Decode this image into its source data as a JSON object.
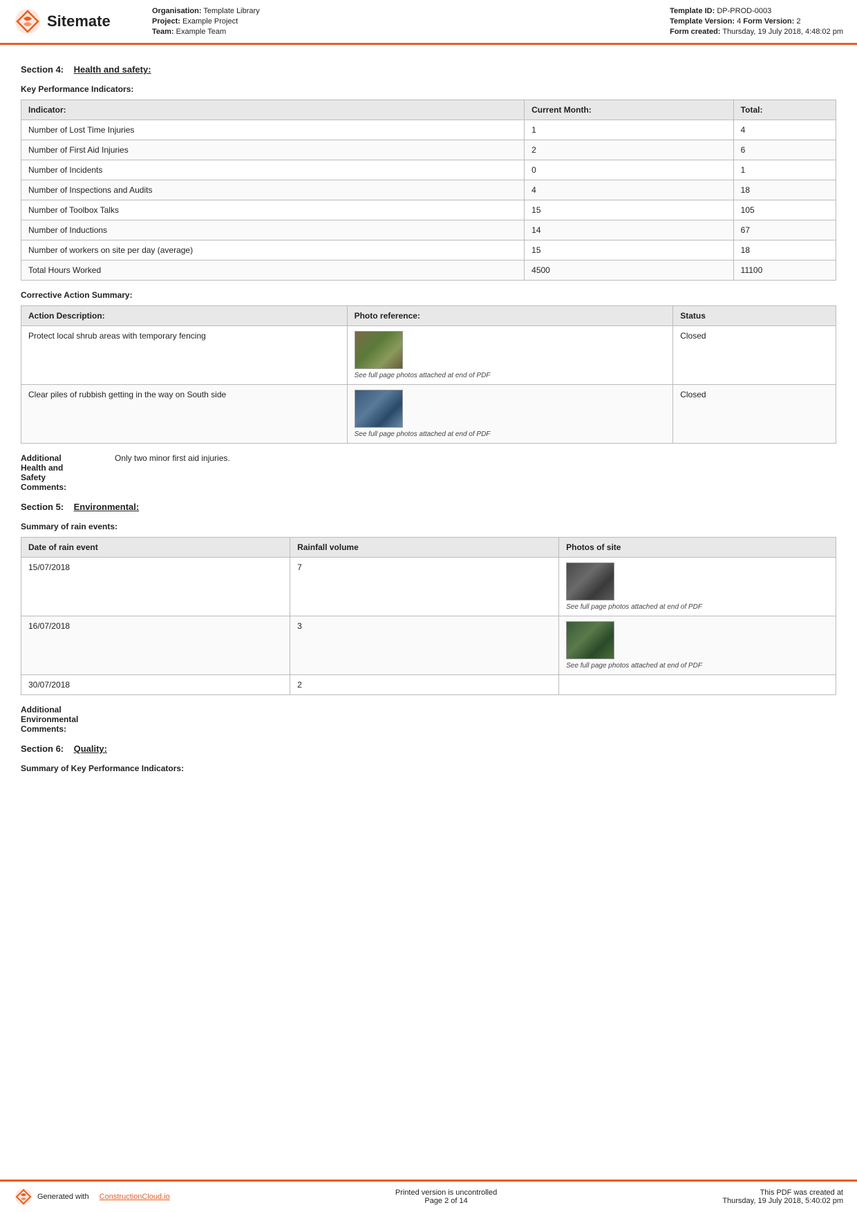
{
  "header": {
    "logo_text": "Sitemate",
    "organisation_label": "Organisation:",
    "organisation_value": "Template Library",
    "project_label": "Project:",
    "project_value": "Example Project",
    "team_label": "Team:",
    "team_value": "Example Team",
    "template_id_label": "Template ID:",
    "template_id_value": "DP-PROD-0003",
    "template_version_label": "Template Version:",
    "template_version_value": "4",
    "form_version_label": "Form Version:",
    "form_version_value": "2",
    "form_created_label": "Form created:",
    "form_created_value": "Thursday, 19 July 2018, 4:48:02 pm"
  },
  "section4": {
    "label": "Section 4:",
    "title": "Health and safety:"
  },
  "kpi": {
    "heading": "Key Performance Indicators:",
    "columns": [
      "Indicator:",
      "Current Month:",
      "Total:"
    ],
    "rows": [
      [
        "Number of Lost Time Injuries",
        "1",
        "4"
      ],
      [
        "Number of First Aid Injuries",
        "2",
        "6"
      ],
      [
        "Number of Incidents",
        "0",
        "1"
      ],
      [
        "Number of Inspections and Audits",
        "4",
        "18"
      ],
      [
        "Number of Toolbox Talks",
        "15",
        "105"
      ],
      [
        "Number of Inductions",
        "14",
        "67"
      ],
      [
        "Number of workers on site per day (average)",
        "15",
        "18"
      ],
      [
        "Total Hours Worked",
        "4500",
        "11100"
      ]
    ]
  },
  "corrective": {
    "heading": "Corrective Action Summary:",
    "columns": [
      "Action Description:",
      "Photo reference:",
      "Status"
    ],
    "rows": [
      {
        "action": "Protect local shrub areas with temporary fencing",
        "photo_note": "See full page photos attached at end of PDF",
        "status": "Closed",
        "img_class": "img-shrub"
      },
      {
        "action": "Clear piles of rubbish getting in the way on South side",
        "photo_note": "See full page photos attached at end of PDF",
        "status": "Closed",
        "img_class": "img-rubbish"
      }
    ]
  },
  "additional_health": {
    "label": "Additional\nHealth and\nSafety\nComments:",
    "value": "Only two minor first aid injuries."
  },
  "section5": {
    "label": "Section 5:",
    "title": "Environmental:"
  },
  "rain": {
    "heading": "Summary of rain events:",
    "columns": [
      "Date of rain event",
      "Rainfall volume",
      "Photos of site"
    ],
    "rows": [
      {
        "date": "15/07/2018",
        "volume": "7",
        "photo_note": "See full page photos attached at end of PDF",
        "img_class": "img-rain1"
      },
      {
        "date": "16/07/2018",
        "volume": "3",
        "photo_note": "See full page photos attached at end of PDF",
        "img_class": "img-rain2"
      },
      {
        "date": "30/07/2018",
        "volume": "2",
        "photo_note": "",
        "img_class": ""
      }
    ]
  },
  "additional_env": {
    "label": "Additional\nEnvironmental\nComments:",
    "value": ""
  },
  "section6": {
    "label": "Section 6:",
    "title": "Quality:"
  },
  "section6_sub": {
    "heading": "Summary of Key Performance Indicators:"
  },
  "footer": {
    "generated_text": "Generated with",
    "link_text": "ConstructionCloud.io",
    "center_text": "Printed version is uncontrolled\nPage 2 of 14",
    "right_text": "This PDF was created at\nThursday, 19 July 2018, 5:40:02 pm"
  }
}
